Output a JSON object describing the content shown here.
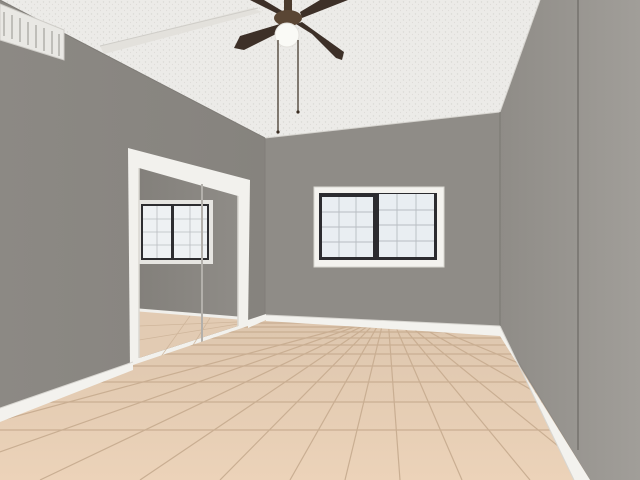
{
  "scene": {
    "kind": "photo",
    "subject": "empty-room",
    "colors": {
      "ceiling": "#ecebe8",
      "wall_back": "#8e8b86",
      "wall_left": "#8a8781",
      "wall_right": "#999690",
      "trim": "#f4f3ef",
      "floor_tile": "#e6cdb3",
      "grout": "#c9ae92",
      "fan_blade": "#3d3028",
      "window_glass": "#e9eef2",
      "window_frame": "#2c2c30"
    },
    "objects": [
      "ceiling-fan",
      "hvac-vent",
      "mirrored-closet-door",
      "double-window",
      "baseboard",
      "ceramic-tile-floor"
    ]
  }
}
